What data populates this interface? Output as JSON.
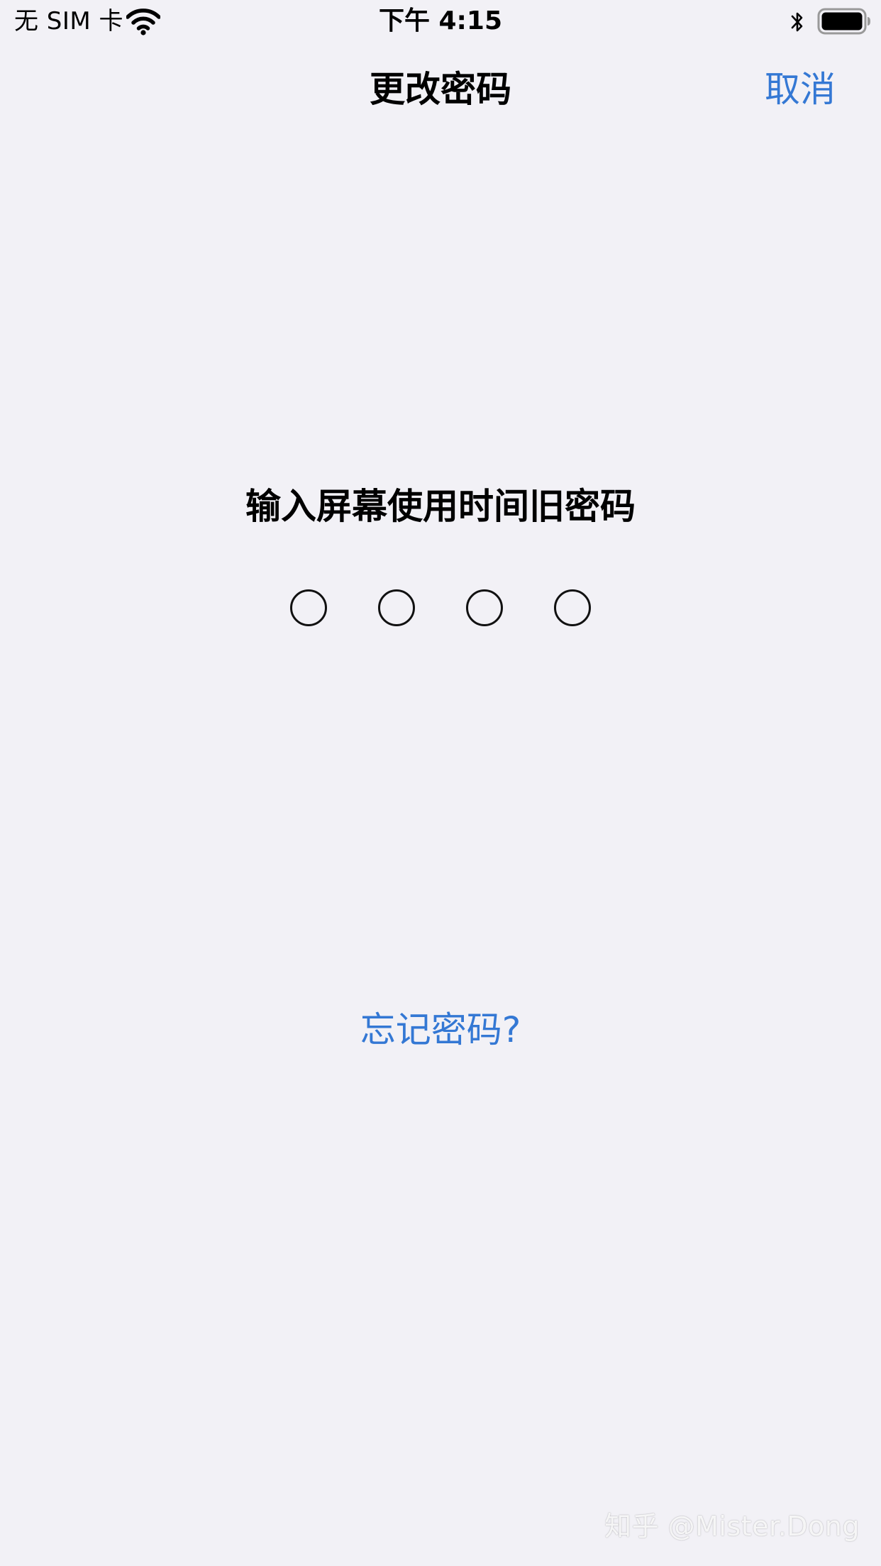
{
  "status_bar": {
    "carrier": "无 SIM 卡",
    "time": "下午 4:15",
    "icons": [
      "wifi-icon",
      "bluetooth-icon",
      "battery-icon"
    ]
  },
  "nav_bar": {
    "title": "更改密码",
    "cancel_label": "取消"
  },
  "passcode": {
    "prompt": "输入屏幕使用时间旧密码",
    "digits_required": 4,
    "digits_entered": 0
  },
  "forgot_label": "忘记密码?",
  "watermark": "知乎 @Mister.Dong",
  "colors": {
    "background": "#f2f1f6",
    "accent": "#3478d4",
    "text": "#000000"
  }
}
